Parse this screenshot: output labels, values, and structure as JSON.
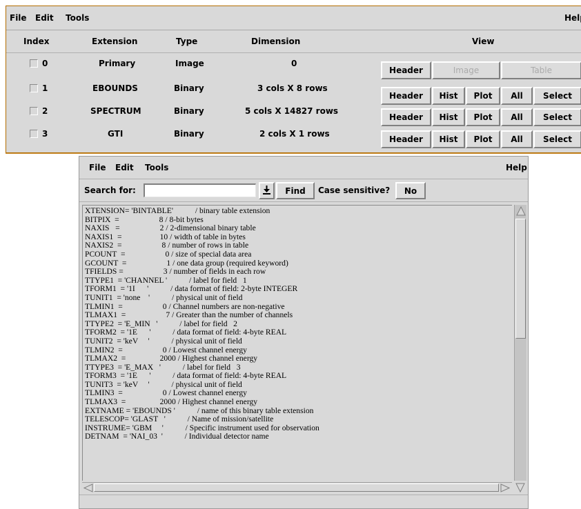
{
  "top_window": {
    "menu": {
      "file": "File",
      "edit": "Edit",
      "tools": "Tools",
      "help": "Help"
    },
    "columns": {
      "index": "Index",
      "extension": "Extension",
      "type": "Type",
      "dimension": "Dimension",
      "view": "View"
    },
    "rows": [
      {
        "index": "0",
        "extension": "Primary",
        "type": "Image",
        "dimension": "0",
        "buttons": {
          "header": "Header",
          "image": "Image",
          "table": "Table"
        }
      },
      {
        "index": "1",
        "extension": "EBOUNDS",
        "type": "Binary",
        "dimension": "3 cols X 8 rows",
        "buttons": {
          "header": "Header",
          "hist": "Hist",
          "plot": "Plot",
          "all": "All",
          "select": "Select"
        }
      },
      {
        "index": "2",
        "extension": "SPECTRUM",
        "type": "Binary",
        "dimension": "5 cols X 14827 rows",
        "buttons": {
          "header": "Header",
          "hist": "Hist",
          "plot": "Plot",
          "all": "All",
          "select": "Select"
        }
      },
      {
        "index": "3",
        "extension": "GTI",
        "type": "Binary",
        "dimension": "2 cols X 1 rows",
        "buttons": {
          "header": "Header",
          "hist": "Hist",
          "plot": "Plot",
          "all": "All",
          "select": "Select"
        }
      }
    ]
  },
  "header_window": {
    "menu": {
      "file": "File",
      "edit": "Edit",
      "tools": "Tools",
      "help": "Help"
    },
    "search": {
      "label": "Search for:",
      "value": "",
      "find": "Find",
      "case_label": "Case sensitive?",
      "case_value": "No"
    },
    "lines": [
      "XTENSION= 'BINTABLE'           / binary table extension",
      "BITPIX  =                    8 / 8-bit bytes",
      "NAXIS   =                    2 / 2-dimensional binary table",
      "NAXIS1  =                   10 / width of table in bytes",
      "NAXIS2  =                    8 / number of rows in table",
      "PCOUNT  =                    0 / size of special data area",
      "GCOUNT  =                    1 / one data group (required keyword)",
      "TFIELDS =                    3 / number of fields in each row",
      "TTYPE1  = 'CHANNEL '           / label for field   1",
      "TFORM1  = '1I      '           / data format of field: 2-byte INTEGER",
      "TUNIT1  = 'none    '           / physical unit of field",
      "TLMIN1  =                    0 / Channel numbers are non-negative",
      "TLMAX1  =                    7 / Greater than the number of channels",
      "TTYPE2  = 'E_MIN   '           / label for field   2",
      "TFORM2  = '1E      '           / data format of field: 4-byte REAL",
      "TUNIT2  = 'keV     '           / physical unit of field",
      "TLMIN2  =                    0 / Lowest channel energy",
      "TLMAX2  =                 2000 / Highest channel energy",
      "TTYPE3  = 'E_MAX   '           / label for field   3",
      "TFORM3  = '1E      '           / data format of field: 4-byte REAL",
      "TUNIT3  = 'keV     '           / physical unit of field",
      "TLMIN3  =                    0 / Lowest channel energy",
      "TLMAX3  =                 2000 / Highest channel energy",
      "EXTNAME = 'EBOUNDS '           / name of this binary table extension",
      "TELESCOP= 'GLAST   '           / Name of mission/satellite",
      "INSTRUME= 'GBM     '           / Specific instrument used for observation",
      "DETNAM  = 'NAI_03  '           / Individual detector name"
    ]
  }
}
